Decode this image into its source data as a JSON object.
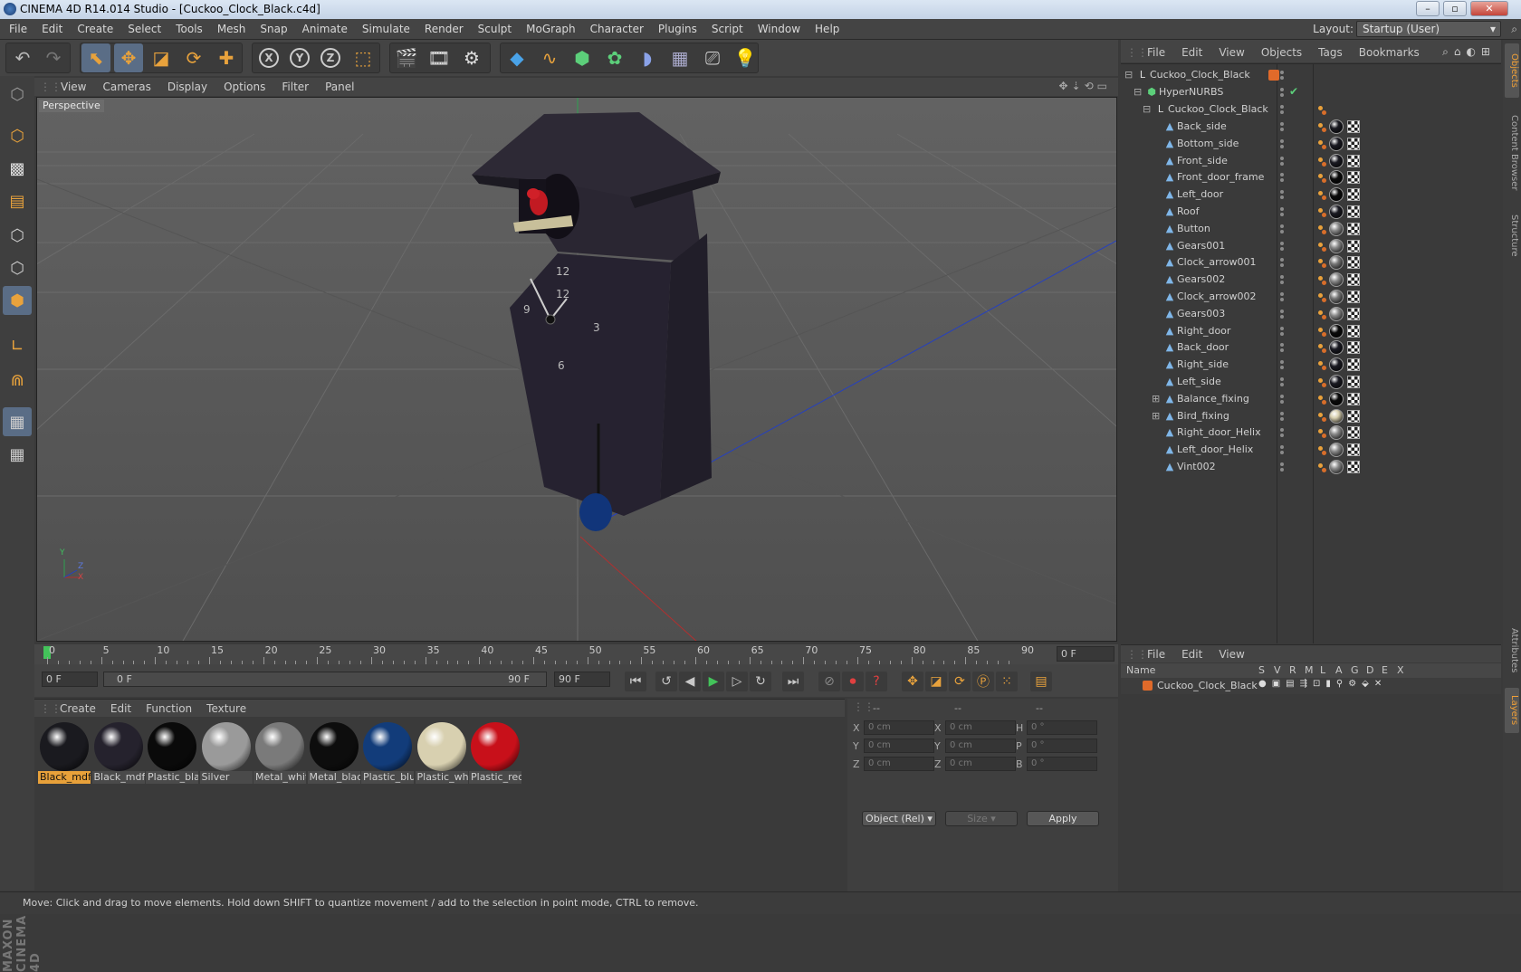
{
  "window": {
    "title": "CINEMA 4D R14.014 Studio - [Cuckoo_Clock_Black.c4d]",
    "minimize": "–",
    "maximize": "▫",
    "close": "✕"
  },
  "menubar": {
    "items": [
      "File",
      "Edit",
      "Create",
      "Select",
      "Tools",
      "Mesh",
      "Snap",
      "Animate",
      "Simulate",
      "Render",
      "Sculpt",
      "MoGraph",
      "Character",
      "Plugins",
      "Script",
      "Window",
      "Help"
    ],
    "layout_label": "Layout:",
    "layout_value": "Startup (User)"
  },
  "toolbar": {
    "x_label": "X",
    "y_label": "Y",
    "z_label": "Z"
  },
  "viewport": {
    "menu": [
      "View",
      "Cameras",
      "Display",
      "Options",
      "Filter",
      "Panel"
    ],
    "label": "Perspective",
    "axis_y": "Y",
    "axis_z": "Z",
    "axis_x": "X"
  },
  "timeline": {
    "ticks": [
      "0",
      "5",
      "10",
      "15",
      "20",
      "25",
      "30",
      "35",
      "40",
      "45",
      "50",
      "55",
      "60",
      "65",
      "70",
      "75",
      "80",
      "85",
      "90"
    ],
    "current": "0 F"
  },
  "transport": {
    "start": "0 F",
    "range_start": "0 F",
    "range_end": "90 F",
    "end": "90 F"
  },
  "materials": {
    "menu": [
      "Create",
      "Edit",
      "Function",
      "Texture"
    ],
    "items": [
      {
        "name": "Black_mdfC",
        "color": "#1a1a1f"
      },
      {
        "name": "Black_mdf",
        "color": "#25222d"
      },
      {
        "name": "Plastic_blac",
        "color": "#0a0a0a"
      },
      {
        "name": "Silver",
        "color": "#9a9a9a"
      },
      {
        "name": "Metal_whit",
        "color": "#7a7a7a"
      },
      {
        "name": "Metal_blac",
        "color": "#0d0d0d"
      },
      {
        "name": "Plastic_blu",
        "color": "#123c7a"
      },
      {
        "name": "Plastic_whi",
        "color": "#d8d0b0"
      },
      {
        "name": "Plastic_red",
        "color": "#c8101a"
      }
    ]
  },
  "coords": {
    "header1": "--",
    "header2": "--",
    "header3": "--",
    "rows": [
      {
        "a": "X",
        "av": "0 cm",
        "b": "X",
        "bv": "0 cm",
        "c": "H",
        "cv": "0 °"
      },
      {
        "a": "Y",
        "av": "0 cm",
        "b": "Y",
        "bv": "0 cm",
        "c": "P",
        "cv": "0 °"
      },
      {
        "a": "Z",
        "av": "0 cm",
        "b": "Z",
        "bv": "0 cm",
        "c": "B",
        "cv": "0 °"
      }
    ],
    "mode": "Object (Rel)",
    "size": "Size",
    "apply": "Apply"
  },
  "objects": {
    "menu": [
      "File",
      "Edit",
      "View",
      "Objects",
      "Tags",
      "Bookmarks"
    ],
    "root": "Cuckoo_Clock_Black",
    "hypernurbs": "HyperNURBS",
    "group": "Cuckoo_Clock_Black",
    "children": [
      {
        "name": "Back_side",
        "mat": "#1a1a22"
      },
      {
        "name": "Bottom_side",
        "mat": "#1a1a22"
      },
      {
        "name": "Front_side",
        "mat": "#1a1a22"
      },
      {
        "name": "Front_door_frame",
        "mat": "#0a0a0a"
      },
      {
        "name": "Left_door",
        "mat": "#0a0a0a"
      },
      {
        "name": "Roof",
        "mat": "#1a1a22"
      },
      {
        "name": "Button",
        "mat": "#8a8a8a"
      },
      {
        "name": "Gears001",
        "mat": "#8a8a8a"
      },
      {
        "name": "Clock_arrow001",
        "mat": "#777777"
      },
      {
        "name": "Gears002",
        "mat": "#8a8a8a"
      },
      {
        "name": "Clock_arrow002",
        "mat": "#777777"
      },
      {
        "name": "Gears003",
        "mat": "#8a8a8a"
      },
      {
        "name": "Right_door",
        "mat": "#0a0a0a"
      },
      {
        "name": "Back_door",
        "mat": "#1a1a22"
      },
      {
        "name": "Right_side",
        "mat": "#1a1a22"
      },
      {
        "name": "Left_side",
        "mat": "#1a1a22"
      },
      {
        "name": "Balance_fixing",
        "mat": "#0a0a0a"
      },
      {
        "name": "Bird_fixing",
        "mat": "#d8d0b0"
      },
      {
        "name": "Right_door_Helix",
        "mat": "#8a8a8a"
      },
      {
        "name": "Left_door_Helix",
        "mat": "#8a8a8a"
      },
      {
        "name": "Vint002",
        "mat": "#8a8a8a"
      }
    ]
  },
  "layers": {
    "menu": [
      "File",
      "Edit",
      "View"
    ],
    "header_name": "Name",
    "columns": [
      "S",
      "V",
      "R",
      "M",
      "L",
      "A",
      "G",
      "D",
      "E",
      "X"
    ],
    "row_name": "Cuckoo_Clock_Black"
  },
  "right_tabs": [
    "Objects",
    "Content Browser",
    "Structure",
    "Attributes",
    "Layers"
  ],
  "branding": "MAXON CINEMA 4D",
  "status": "Move: Click and drag to move elements. Hold down SHIFT to quantize movement / add to the selection in point mode, CTRL to remove."
}
